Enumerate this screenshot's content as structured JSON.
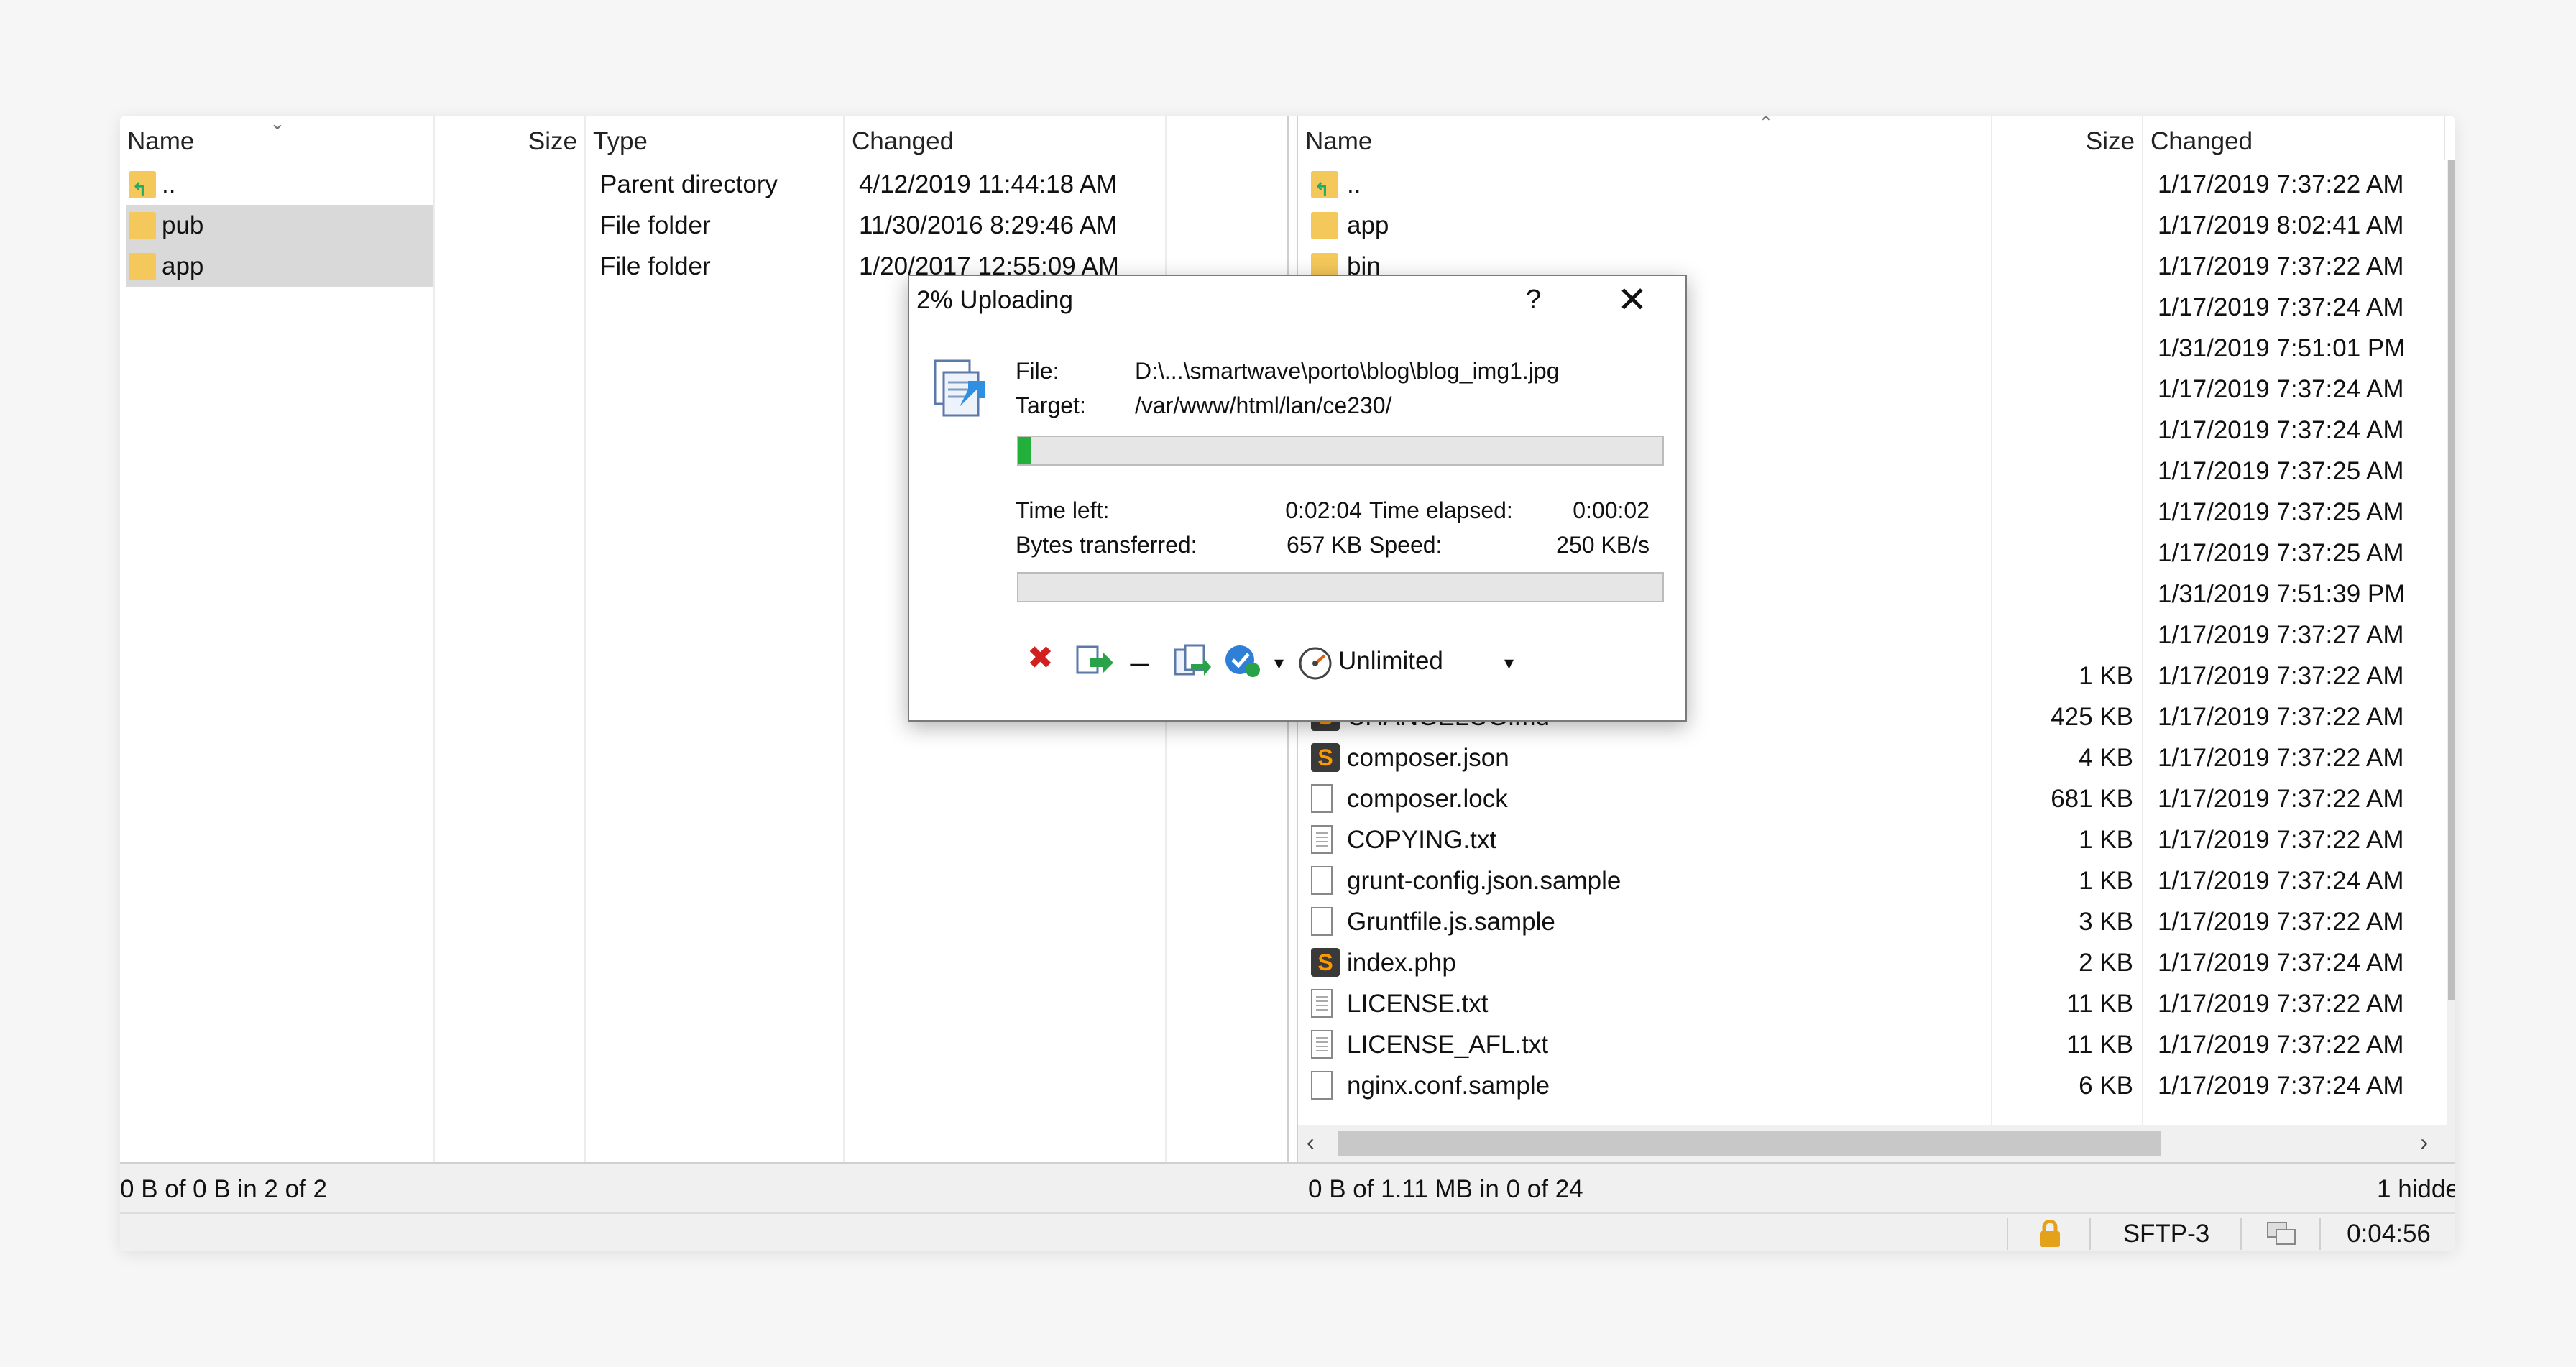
{
  "left_pane": {
    "columns": {
      "name": "Name",
      "size": "Size",
      "type": "Type",
      "changed": "Changed"
    },
    "rows": [
      {
        "name": "..",
        "type": "Parent directory",
        "changed": "4/12/2019  11:44:18 AM",
        "icon": "parent-dir-icon",
        "selected": false
      },
      {
        "name": "pub",
        "type": "File folder",
        "changed": "11/30/2016  8:29:46 AM",
        "icon": "folder-icon",
        "selected": true
      },
      {
        "name": "app",
        "type": "File folder",
        "changed": "1/20/2017  12:55:09 AM",
        "icon": "folder-icon",
        "selected": true
      }
    ],
    "status": "0 B of 0 B in 2 of 2"
  },
  "right_pane": {
    "columns": {
      "name": "Name",
      "size": "Size",
      "changed": "Changed"
    },
    "rows": [
      {
        "name": "..",
        "size": "",
        "changed": "1/17/2019 7:37:22 AM",
        "icon": "parent-dir-icon"
      },
      {
        "name": "app",
        "size": "",
        "changed": "1/17/2019 8:02:41 AM",
        "icon": "folder-icon"
      },
      {
        "name": "bin",
        "size": "",
        "changed": "1/17/2019 7:37:22 AM",
        "icon": "folder-icon"
      },
      {
        "name": "",
        "size": "",
        "changed": "1/17/2019 7:37:24 AM",
        "icon": "folder-icon"
      },
      {
        "name": "",
        "size": "",
        "changed": "1/31/2019 7:51:01 PM",
        "icon": "folder-icon"
      },
      {
        "name": "",
        "size": "",
        "changed": "1/17/2019 7:37:24 AM",
        "icon": "folder-icon"
      },
      {
        "name": "",
        "size": "",
        "changed": "1/17/2019 7:37:24 AM",
        "icon": "folder-icon"
      },
      {
        "name": "",
        "size": "",
        "changed": "1/17/2019 7:37:25 AM",
        "icon": "folder-icon"
      },
      {
        "name": "",
        "size": "",
        "changed": "1/17/2019 7:37:25 AM",
        "icon": "folder-icon"
      },
      {
        "name": "",
        "size": "",
        "changed": "1/17/2019 7:37:25 AM",
        "icon": "folder-icon"
      },
      {
        "name": "",
        "size": "",
        "changed": "1/31/2019 7:51:39 PM",
        "icon": "folder-icon"
      },
      {
        "name": "",
        "size": "",
        "changed": "1/17/2019 7:37:27 AM",
        "icon": "folder-icon"
      },
      {
        "name": "",
        "size": "1 KB",
        "changed": "1/17/2019 7:37:22 AM",
        "icon": "file-icon"
      },
      {
        "name": "CHANGELOG.md",
        "size": "425 KB",
        "changed": "1/17/2019 7:37:22 AM",
        "icon": "sublime-file-icon"
      },
      {
        "name": "composer.json",
        "size": "4 KB",
        "changed": "1/17/2019 7:37:22 AM",
        "icon": "sublime-file-icon"
      },
      {
        "name": "composer.lock",
        "size": "681 KB",
        "changed": "1/17/2019 7:37:22 AM",
        "icon": "file-icon"
      },
      {
        "name": "COPYING.txt",
        "size": "1 KB",
        "changed": "1/17/2019 7:37:22 AM",
        "icon": "text-file-icon"
      },
      {
        "name": "grunt-config.json.sample",
        "size": "1 KB",
        "changed": "1/17/2019 7:37:24 AM",
        "icon": "file-icon"
      },
      {
        "name": "Gruntfile.js.sample",
        "size": "3 KB",
        "changed": "1/17/2019 7:37:22 AM",
        "icon": "file-icon"
      },
      {
        "name": "index.php",
        "size": "2 KB",
        "changed": "1/17/2019 7:37:24 AM",
        "icon": "sublime-file-icon"
      },
      {
        "name": "LICENSE.txt",
        "size": "11 KB",
        "changed": "1/17/2019 7:37:22 AM",
        "icon": "text-file-icon"
      },
      {
        "name": "LICENSE_AFL.txt",
        "size": "11 KB",
        "changed": "1/17/2019 7:37:22 AM",
        "icon": "text-file-icon"
      },
      {
        "name": "nginx.conf.sample",
        "size": "6 KB",
        "changed": "1/17/2019 7:37:24 AM",
        "icon": "file-icon"
      }
    ],
    "status": "0 B of 1.11 MB in 0 of 24",
    "hidden_note": "1 hidde"
  },
  "statusbar": {
    "protocol": "SFTP-3",
    "time": "0:04:56"
  },
  "dialog": {
    "title": "2% Uploading",
    "help": "?",
    "close": "✕",
    "file_label": "File:",
    "file_value": "D:\\...\\smartwave\\porto\\blog\\blog_img1.jpg",
    "target_label": "Target:",
    "target_value": "/var/www/html/lan/ce230/",
    "file_progress": 0.02,
    "total_progress": 0.0,
    "time_left_label": "Time left:",
    "time_left": "0:02:04",
    "time_elapsed_label": "Time elapsed:",
    "time_elapsed": "0:00:02",
    "bytes_label": "Bytes transferred:",
    "bytes": "657 KB",
    "speed_label": "Speed:",
    "speed": "250 KB/s",
    "speed_limit": "Unlimited"
  }
}
